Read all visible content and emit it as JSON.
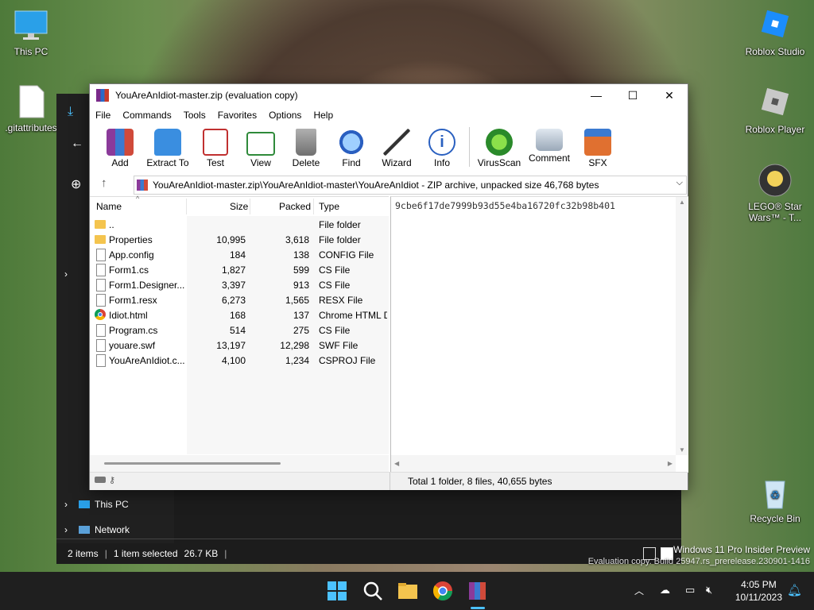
{
  "desktop_icons": {
    "this_pc": "This PC",
    "gitattributes": ".gitattributes",
    "roblox_studio": "Roblox Studio",
    "roblox_player": "Roblox Player",
    "lego": "LEGO® Star Wars™ - T...",
    "recycle_bin": "Recycle Bin"
  },
  "explorer": {
    "nav_this_pc": "This PC",
    "nav_network": "Network",
    "status_items": "2 items",
    "status_selected": "1 item selected",
    "status_size": "26.7 KB"
  },
  "winrar": {
    "title": "YouAreAnIdiot-master.zip (evaluation copy)",
    "menu": [
      "File",
      "Commands",
      "Tools",
      "Favorites",
      "Options",
      "Help"
    ],
    "toolbar": [
      "Add",
      "Extract To",
      "Test",
      "View",
      "Delete",
      "Find",
      "Wizard",
      "Info",
      "VirusScan",
      "Comment",
      "SFX"
    ],
    "address": "YouAreAnIdiot-master.zip\\YouAreAnIdiot-master\\YouAreAnIdiot - ZIP archive, unpacked size 46,768 bytes",
    "columns": {
      "name": "Name",
      "size": "Size",
      "packed": "Packed",
      "type": "Type"
    },
    "files": [
      {
        "icon": "folder",
        "name": "..",
        "size": "",
        "packed": "",
        "type": "File folder"
      },
      {
        "icon": "folder",
        "name": "Properties",
        "size": "10,995",
        "packed": "3,618",
        "type": "File folder"
      },
      {
        "icon": "file",
        "name": "App.config",
        "size": "184",
        "packed": "138",
        "type": "CONFIG File"
      },
      {
        "icon": "file",
        "name": "Form1.cs",
        "size": "1,827",
        "packed": "599",
        "type": "CS File"
      },
      {
        "icon": "file",
        "name": "Form1.Designer....",
        "size": "3,397",
        "packed": "913",
        "type": "CS File"
      },
      {
        "icon": "file",
        "name": "Form1.resx",
        "size": "6,273",
        "packed": "1,565",
        "type": "RESX File"
      },
      {
        "icon": "chrome",
        "name": "Idiot.html",
        "size": "168",
        "packed": "137",
        "type": "Chrome HTML D"
      },
      {
        "icon": "file",
        "name": "Program.cs",
        "size": "514",
        "packed": "275",
        "type": "CS File"
      },
      {
        "icon": "file",
        "name": "youare.swf",
        "size": "13,197",
        "packed": "12,298",
        "type": "SWF File"
      },
      {
        "icon": "file",
        "name": "YouAreAnIdiot.c...",
        "size": "4,100",
        "packed": "1,234",
        "type": "CSPROJ File"
      }
    ],
    "preview_hash": "9cbe6f17de7999b93d55e4ba16720fc32b98b401",
    "status_total": "Total 1 folder, 8 files, 40,655 bytes"
  },
  "watermark": {
    "line1": "Windows 11 Pro Insider Preview",
    "line2": "Evaluation copy. Build 25947.rs_prerelease.230901-1416"
  },
  "clock": {
    "time": "4:05 PM",
    "date": "10/11/2023"
  }
}
